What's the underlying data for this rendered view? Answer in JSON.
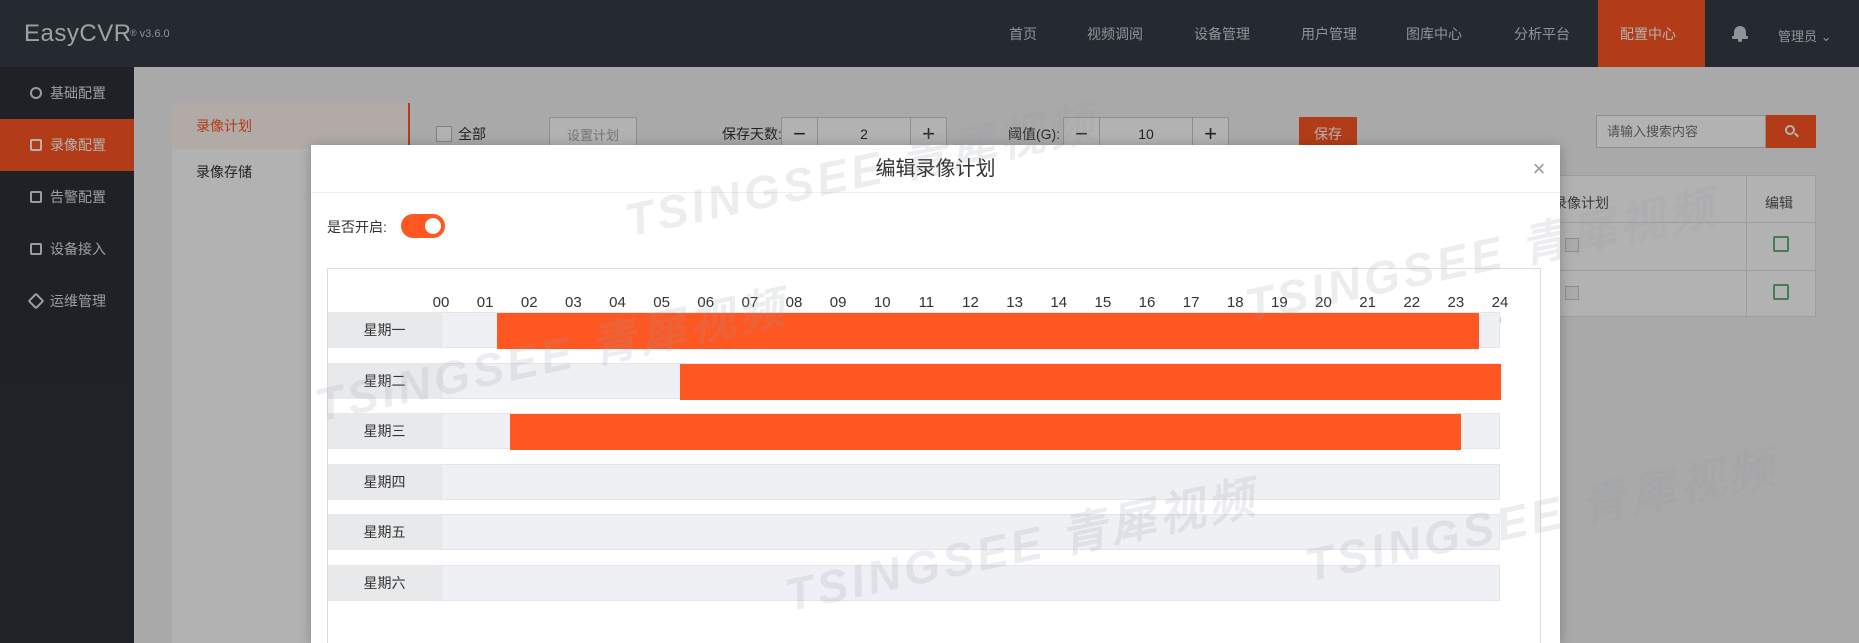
{
  "app": {
    "logo": "EasyCVR",
    "version": "v3.6.0",
    "reg": "®"
  },
  "topnav": {
    "items": [
      {
        "label": "首页",
        "icon": "dashboard-icon"
      },
      {
        "label": "视频调阅",
        "icon": "play-icon"
      },
      {
        "label": "设备管理",
        "icon": "device-icon"
      },
      {
        "label": "用户管理",
        "icon": "user-icon"
      },
      {
        "label": "图库中心",
        "icon": "gallery-icon"
      },
      {
        "label": "分析平台",
        "icon": "analysis-icon"
      },
      {
        "label": "配置中心",
        "icon": "gear-icon",
        "active": true
      }
    ],
    "user": "管理员 ⌄"
  },
  "sidebar": {
    "items": [
      {
        "label": "基础配置",
        "icon": "gear-icon"
      },
      {
        "label": "录像配置",
        "icon": "record-icon",
        "active": true
      },
      {
        "label": "告警配置",
        "icon": "alarm-icon"
      },
      {
        "label": "设备接入",
        "icon": "list-icon"
      },
      {
        "label": "运维管理",
        "icon": "tools-icon"
      }
    ]
  },
  "subnav": {
    "items": [
      "录像计划",
      "录像存储"
    ]
  },
  "toolbar": {
    "all_label": "全部",
    "set_plan": "设置计划",
    "days_label": "保存天数:",
    "days_value": "2",
    "threshold_label": "阈值(G):",
    "threshold_value": "10",
    "save": "保存",
    "search_placeholder": "请输入搜索内容"
  },
  "table": {
    "col_plan": "录像计划",
    "col_edit": "编辑"
  },
  "modal": {
    "title": "编辑录像计划",
    "close": "×",
    "enable_label": "是否开启:",
    "enabled": true,
    "hours": [
      "00",
      "01",
      "02",
      "03",
      "04",
      "05",
      "06",
      "07",
      "08",
      "09",
      "10",
      "11",
      "12",
      "13",
      "14",
      "15",
      "16",
      "17",
      "18",
      "19",
      "20",
      "21",
      "22",
      "23",
      "24"
    ],
    "days": [
      {
        "label": "星期一",
        "start": 1.25,
        "end": 23.5
      },
      {
        "label": "星期二",
        "start": 5.4,
        "end": 24
      },
      {
        "label": "星期三",
        "start": 1.55,
        "end": 23.1
      },
      {
        "label": "星期四",
        "start": null,
        "end": null
      },
      {
        "label": "星期五",
        "start": null,
        "end": null
      },
      {
        "label": "星期六",
        "start": null,
        "end": null
      }
    ]
  },
  "watermark": "TSINGSEE 青犀视频",
  "colors": {
    "accent": "#ff5722",
    "nav_bg": "#363d46",
    "sidebar_bg": "#2c3238"
  }
}
